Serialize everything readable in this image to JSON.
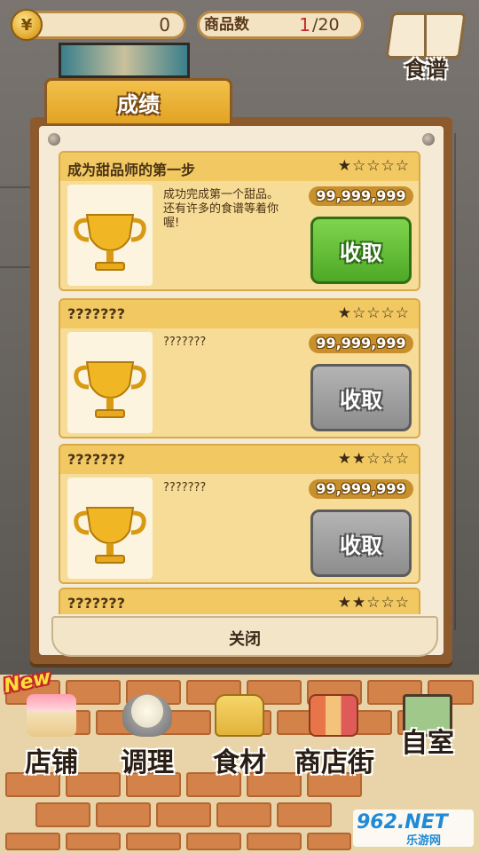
{
  "header": {
    "coin_icon_glyph": "¥",
    "coins": "0",
    "items_label": "商品数",
    "items_current": "1",
    "items_max": "/20",
    "recipe_label": "食谱"
  },
  "panel": {
    "tab_label": "成绩",
    "close_label": "关闭",
    "achievements": [
      {
        "title": "成为甜品师的第一步",
        "stars": "★☆☆☆☆",
        "description": "成功完成第一个甜品。还有许多的食谱等着你喔!",
        "reward": "99,999,999",
        "claim_label": "收取",
        "claim_state": "active"
      },
      {
        "title": "???????",
        "stars": "★☆☆☆☆",
        "description": "???????",
        "reward": "99,999,999",
        "claim_label": "收取",
        "claim_state": "disabled"
      },
      {
        "title": "???????",
        "stars": "★★☆☆☆",
        "description": "???????",
        "reward": "99,999,999",
        "claim_label": "收取",
        "claim_state": "disabled"
      },
      {
        "title": "???????",
        "stars": "★★☆☆☆"
      }
    ]
  },
  "bottom_nav": {
    "new_badge": "New",
    "items": [
      {
        "label": "店铺",
        "icon": "cake-icon"
      },
      {
        "label": "调理",
        "icon": "mixing-bowl-icon"
      },
      {
        "label": "食材",
        "icon": "flour-sack-icon"
      },
      {
        "label": "商店街",
        "icon": "shops-icon"
      },
      {
        "label": "自室",
        "icon": "staff-only-sign-icon"
      }
    ]
  },
  "watermark": {
    "brand": "962.NET",
    "sub": "乐游网"
  },
  "colors": {
    "claim_active": "#4ea927",
    "claim_disabled": "#8d8d8d",
    "panel_frame": "#8c5a2c",
    "tab": "#f2c04a"
  }
}
